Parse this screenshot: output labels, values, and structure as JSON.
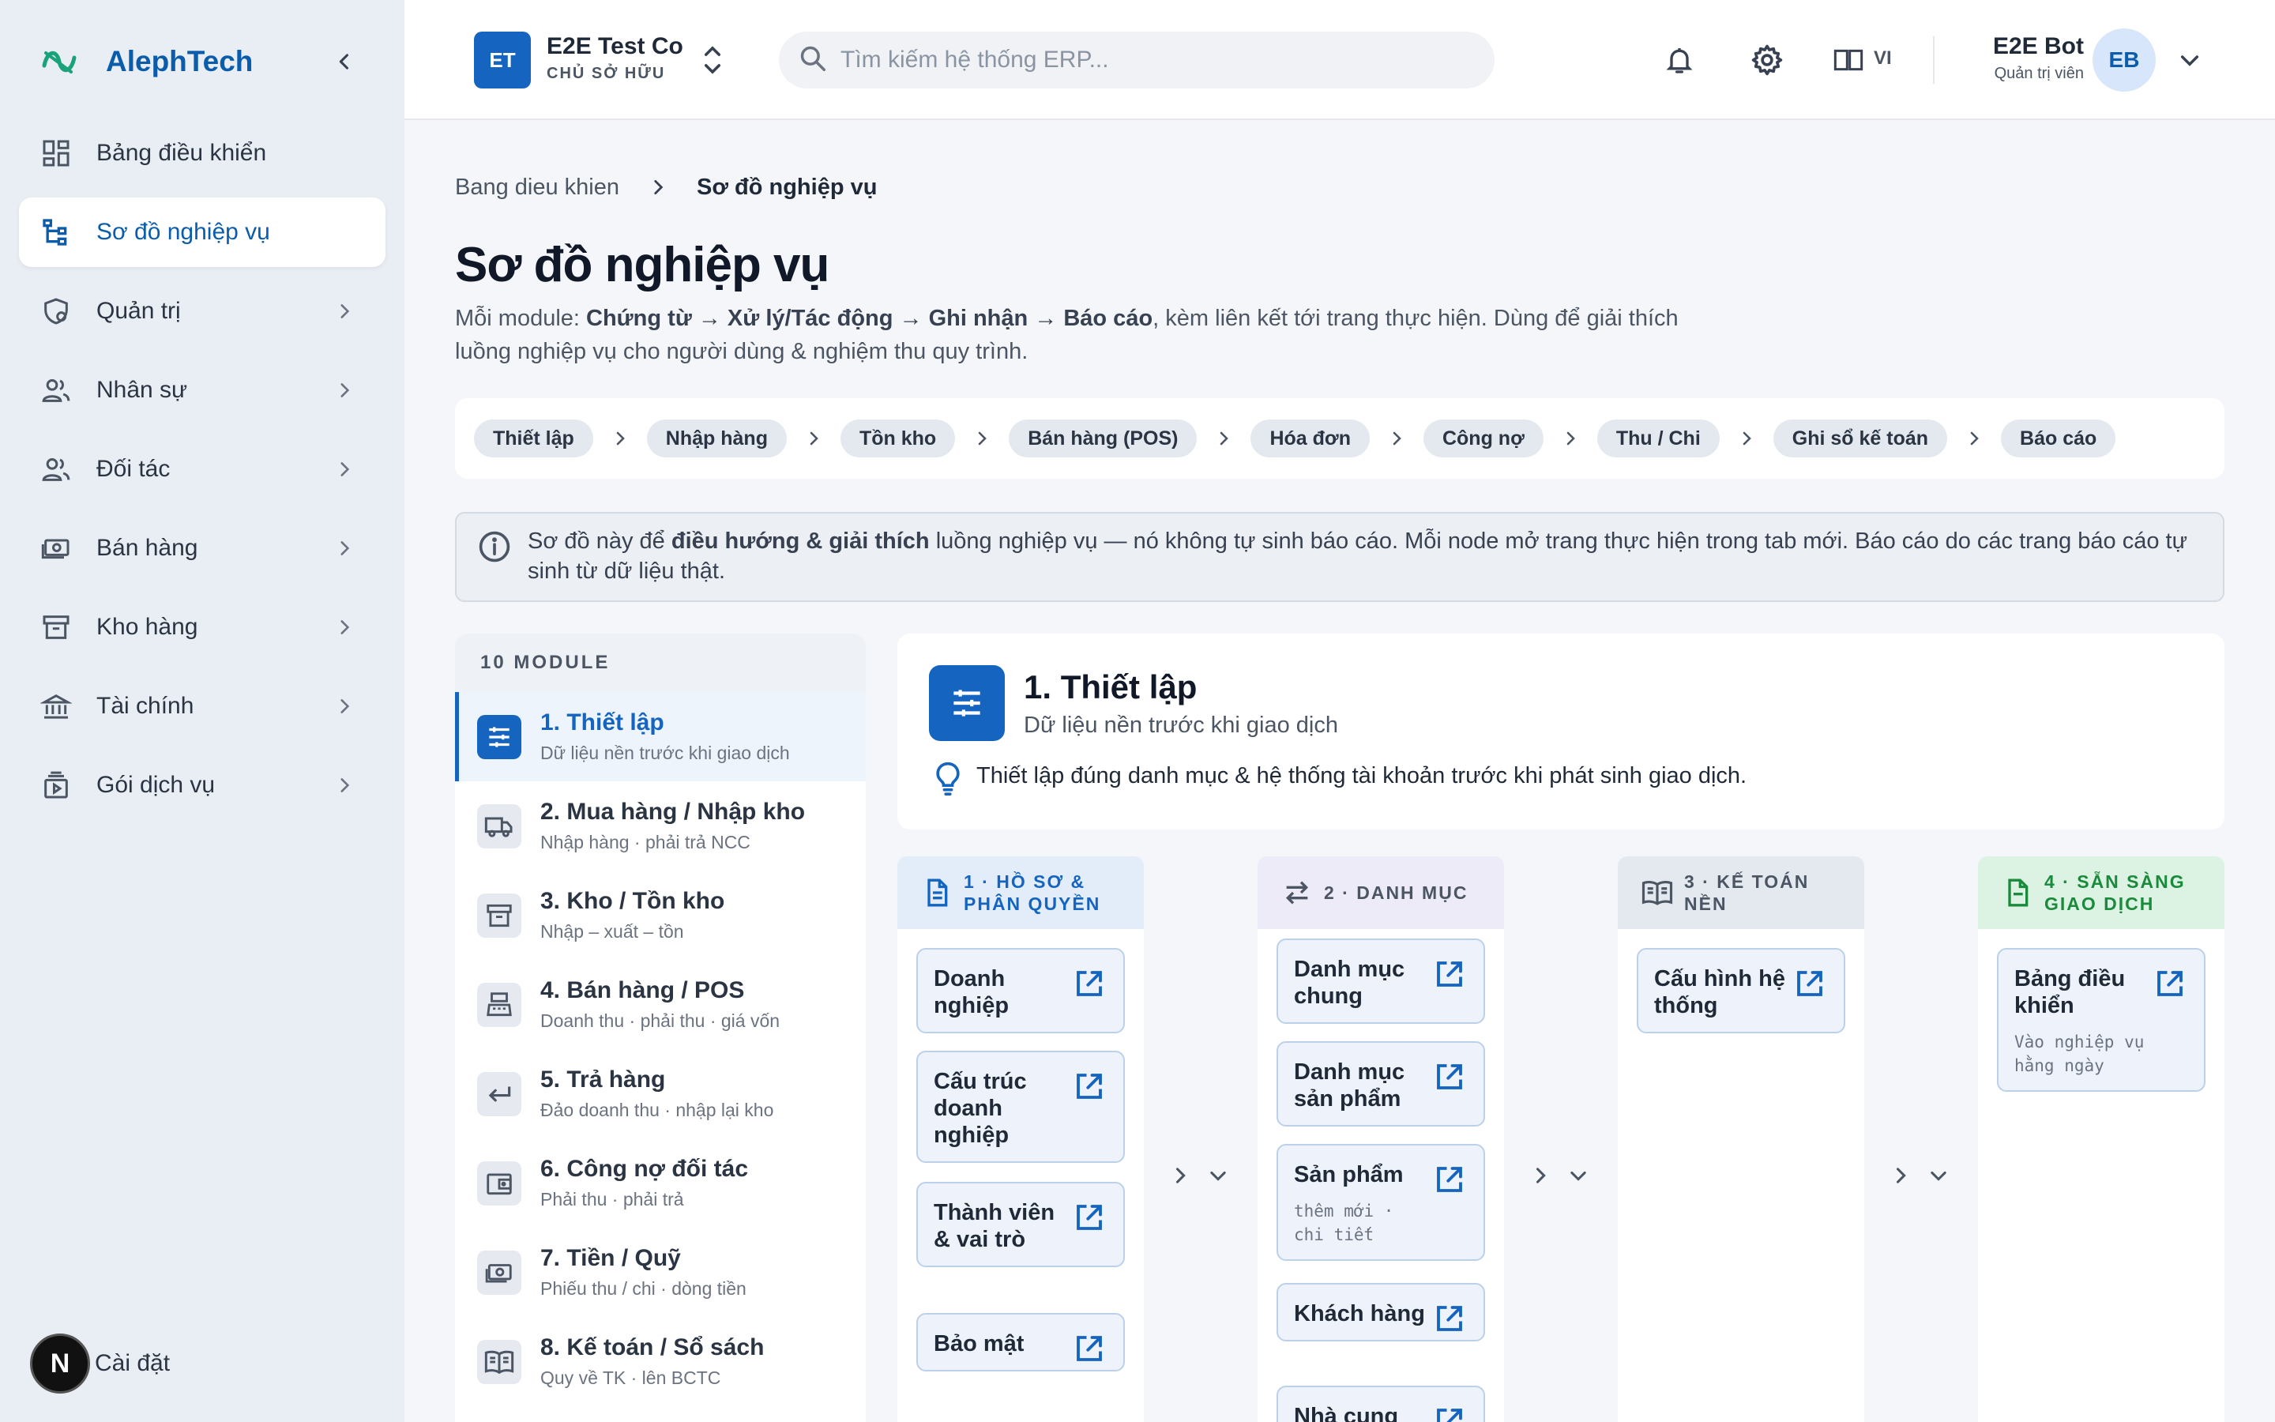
{
  "brand": {
    "name": "AlephTech"
  },
  "sidebar": {
    "items": [
      {
        "label": "Bảng điều khiển",
        "icon": "dashboard-icon"
      },
      {
        "label": "Sơ đồ nghiệp vụ",
        "icon": "sitemap-icon"
      },
      {
        "label": "Quản trị",
        "icon": "admin-shield-icon"
      },
      {
        "label": "Nhân sự",
        "icon": "people-icon"
      },
      {
        "label": "Đối tác",
        "icon": "partners-icon"
      },
      {
        "label": "Bán hàng",
        "icon": "cash-icon"
      },
      {
        "label": "Kho hàng",
        "icon": "archive-icon"
      },
      {
        "label": "Tài chính",
        "icon": "bank-icon"
      },
      {
        "label": "Gói dịch vụ",
        "icon": "subscription-icon"
      }
    ],
    "settings_label": "Cài đặt",
    "badge": "N"
  },
  "header": {
    "org_initials": "ET",
    "org_name": "E2E Test Co",
    "org_role": "CHỦ SỞ HỮU",
    "search_placeholder": "Tìm kiếm hệ thống ERP...",
    "lang_code": "VI",
    "user_name": "E2E Bot",
    "user_role": "Quản trị viên",
    "user_initials": "EB"
  },
  "breadcrumb": {
    "home": "Bang dieu khien",
    "current": "Sơ đồ nghiệp vụ"
  },
  "page": {
    "title": "Sơ đồ nghiệp vụ",
    "desc_prefix": "Mỗi module: ",
    "desc_bold": "Chứng từ → Xử lý/Tác động → Ghi nhận → Báo cáo",
    "desc_suffix": ", kèm liên kết tới trang thực hiện. Dùng để giải thích luồng nghiệp vụ cho người dùng & nghiệm thu quy trình."
  },
  "flow": [
    "Thiết lập",
    "Nhập hàng",
    "Tồn kho",
    "Bán hàng (POS)",
    "Hóa đơn",
    "Công nợ",
    "Thu / Chi",
    "Ghi sổ kế toán",
    "Báo cáo"
  ],
  "info": {
    "prefix": "Sơ đồ này để ",
    "bold": "điều hướng & giải thích",
    "suffix": " luồng nghiệp vụ — nó không tự sinh báo cáo. Mỗi node mở trang thực hiện trong tab mới. Báo cáo do các trang báo cáo tự sinh từ dữ liệu thật."
  },
  "modules": {
    "count_label": "10 MODULE",
    "items": [
      {
        "title": "1. Thiết lập",
        "sub": "Dữ liệu nền trước khi giao dịch",
        "icon": "sliders-icon"
      },
      {
        "title": "2. Mua hàng / Nhập kho",
        "sub": "Nhập hàng · phải trả NCC",
        "icon": "truck-icon"
      },
      {
        "title": "3. Kho / Tồn kho",
        "sub": "Nhập – xuất – tồn",
        "icon": "archive-icon"
      },
      {
        "title": "4. Bán hàng / POS",
        "sub": "Doanh thu · phải thu · giá vốn",
        "icon": "register-icon"
      },
      {
        "title": "5. Trả hàng",
        "sub": "Đảo doanh thu · nhập lại kho",
        "icon": "return-arrow-icon"
      },
      {
        "title": "6. Công nợ đối tác",
        "sub": "Phải thu · phải trả",
        "icon": "wallet-icon"
      },
      {
        "title": "7. Tiền / Quỹ",
        "sub": "Phiếu thu / chi · dòng tiền",
        "icon": "cash-icon"
      },
      {
        "title": "8. Kế toán / Sổ sách",
        "sub": "Quy về TK · lên BCTC",
        "icon": "book-icon"
      }
    ]
  },
  "detail": {
    "title": "1. Thiết lập",
    "sub": "Dữ liệu nền trước khi giao dịch",
    "tip": "Thiết lập đúng danh mục & hệ thống tài khoản trước khi phát sinh giao dịch."
  },
  "columns": [
    {
      "title_l1": "1 · HỒ SƠ &",
      "title_l2": "PHÂN QUYỀN",
      "icon": "document-icon",
      "bg": "#e3edfa",
      "fg": "#1565c0",
      "nodes": [
        {
          "title": "Doanh nghiệp",
          "note": ""
        },
        {
          "title": "Cấu trúc doanh nghiệp",
          "note": ""
        },
        {
          "title": "Thành viên & vai trò",
          "note": ""
        },
        {
          "title": "Bảo mật",
          "note": ""
        }
      ]
    },
    {
      "title_l1": "2 · DANH MỤC",
      "title_l2": "",
      "icon": "swap-icon",
      "bg": "#ecebf7",
      "fg": "#4b5563",
      "nodes": [
        {
          "title": "Danh mục chung",
          "note": ""
        },
        {
          "title": "Danh mục sản phẩm",
          "note": ""
        },
        {
          "title": "Sản phẩm",
          "note": "thêm mới · chi tiết"
        },
        {
          "title": "Khách hàng",
          "note": ""
        },
        {
          "title": "Nhà cung",
          "note": ""
        }
      ]
    },
    {
      "title_l1": "3 · KẾ TOÁN",
      "title_l2": "NỀN",
      "icon": "book-icon",
      "bg": "#e4e9f0",
      "fg": "#4b5563",
      "nodes": [
        {
          "title": "Cấu hình hệ thống",
          "note": ""
        }
      ]
    },
    {
      "title_l1": "4 · SẴN SÀNG",
      "title_l2": "GIAO DỊCH",
      "icon": "ready-doc-icon",
      "bg": "#dcf3e4",
      "fg": "#1b8a3c",
      "nodes": [
        {
          "title": "Bảng điều khiển",
          "note": "Vào nghiệp vụ hằng ngày"
        }
      ]
    }
  ],
  "colors": {
    "accent": "#1565c0",
    "brand": "#0b5cab",
    "sidebar_bg": "#e9eef4",
    "success": "#1b8a3c"
  }
}
